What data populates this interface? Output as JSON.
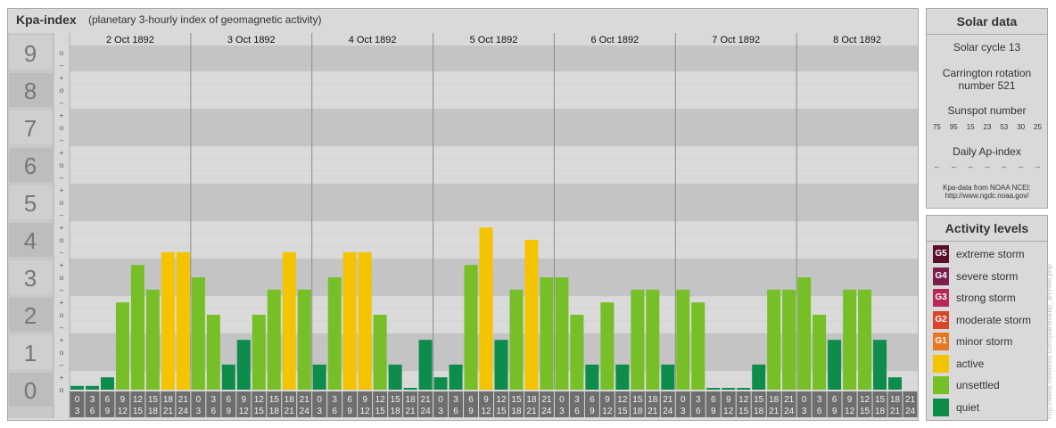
{
  "header": {
    "title": "Kpa-index",
    "subtitle": "(planetary 3-hourly index of geomagnetic activity)"
  },
  "solar_panel": {
    "title": "Solar data",
    "solar_cycle": "Solar cycle 13",
    "carrington_line1": "Carrington rotation",
    "carrington_line2": "number 521",
    "sunspot_label": "Sunspot number",
    "sunspot_values": [
      "75",
      "95",
      "15",
      "23",
      "53",
      "30",
      "25"
    ],
    "ap_label": "Daily Ap-index",
    "ap_values": [
      "--",
      "--",
      "--",
      "--",
      "--",
      "--",
      "--"
    ],
    "source_line1": "Kpa-data from NOAA NCEI:",
    "source_line2": "http://www.ngdc.noaa.gov/"
  },
  "legend": {
    "title": "Activity levels",
    "items": [
      {
        "badge": "G5",
        "label": "extreme storm",
        "color": "#5a0f2e"
      },
      {
        "badge": "G4",
        "label": "severe storm",
        "color": "#7a1f4a"
      },
      {
        "badge": "G3",
        "label": "strong storm",
        "color": "#b8265a"
      },
      {
        "badge": "G2",
        "label": "moderate storm",
        "color": "#d9442b"
      },
      {
        "badge": "G1",
        "label": "minor storm",
        "color": "#e87722"
      },
      {
        "badge": "",
        "label": "active",
        "color": "#f5c400"
      },
      {
        "badge": "",
        "label": "unsettled",
        "color": "#77bf26"
      },
      {
        "badge": "",
        "label": "quiet",
        "color": "#0e8c4c"
      }
    ]
  },
  "watermark": "http://www.freewebs.com/planeta/kp_archive.php",
  "chart_data": {
    "type": "bar",
    "days": [
      "2 Oct 1892",
      "3 Oct 1892",
      "4 Oct 1892",
      "5 Oct 1892",
      "6 Oct 1892",
      "7 Oct 1892",
      "8 Oct 1892"
    ],
    "intervals": [
      [
        "0",
        "3"
      ],
      [
        "3",
        "6"
      ],
      [
        "6",
        "9"
      ],
      [
        "9",
        "12"
      ],
      [
        "12",
        "15"
      ],
      [
        "15",
        "18"
      ],
      [
        "18",
        "21"
      ],
      [
        "21",
        "24"
      ]
    ],
    "y_major_ticks": [
      "0",
      "1",
      "2",
      "3",
      "4",
      "5",
      "6",
      "7",
      "8",
      "9"
    ],
    "y_minor_ticks": [
      "o",
      "+",
      "–",
      "o",
      "+",
      "–",
      "o",
      "+",
      "–",
      "o",
      "+",
      "–",
      "o",
      "+",
      "–",
      "o",
      "+",
      "–",
      "o",
      "+",
      "–",
      "o",
      "+",
      "–",
      "o",
      "+",
      "–",
      "o"
    ],
    "ylim": [
      0,
      9
    ],
    "values": [
      0.1,
      0.1,
      0.33,
      2.33,
      3.33,
      2.67,
      3.67,
      3.67,
      3.0,
      2.0,
      0.67,
      1.33,
      2.0,
      2.67,
      3.67,
      2.67,
      0.67,
      3.0,
      3.67,
      3.67,
      2.0,
      0.67,
      0.0,
      1.33,
      0.33,
      0.67,
      3.33,
      4.33,
      1.33,
      2.67,
      4.0,
      3.0,
      3.0,
      2.0,
      0.67,
      2.33,
      0.67,
      2.67,
      2.67,
      0.67,
      2.67,
      2.33,
      0.0,
      0.0,
      0.0,
      0.67,
      2.67,
      2.67,
      3.0,
      2.0,
      1.33,
      2.67,
      2.67,
      1.33,
      0.33
    ],
    "colors": {
      "quiet": "#0e8c4c",
      "unsettled": "#77bf26",
      "active": "#f5c400"
    }
  }
}
